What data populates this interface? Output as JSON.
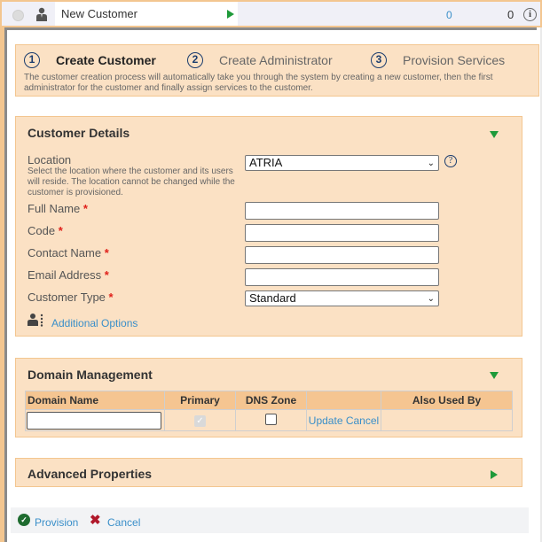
{
  "header": {
    "title": "New Customer",
    "count_link": "0",
    "count": "0",
    "icons": [
      "status-radio",
      "user-icon",
      "play-icon",
      "info-icon"
    ]
  },
  "steps": {
    "items": [
      {
        "number": "1",
        "label": "Create Customer",
        "active": true
      },
      {
        "number": "2",
        "label": "Create Administrator",
        "active": false
      },
      {
        "number": "3",
        "label": "Provision Services",
        "active": false
      }
    ],
    "description": "The customer creation process will automatically take you through the system by creating a new customer, then the first administrator for the customer and finally assign services to the customer."
  },
  "customer_details": {
    "title": "Customer Details",
    "location": {
      "label": "Location",
      "help": "Select the location where the customer and its users will reside. The location cannot be changed while the customer is provisioned.",
      "value": "ATRIA"
    },
    "fields": [
      {
        "label": "Full Name",
        "value": "",
        "required": true
      },
      {
        "label": "Code",
        "value": "",
        "required": true
      },
      {
        "label": "Contact Name",
        "value": "",
        "required": true
      },
      {
        "label": "Email Address",
        "value": "",
        "required": true
      }
    ],
    "customer_type": {
      "label": "Customer Type",
      "value": "Standard",
      "required": true
    },
    "required_marker": "*",
    "additional_options": "Additional Options"
  },
  "domain_management": {
    "title": "Domain Management",
    "columns": [
      "Domain Name",
      "Primary",
      "DNS Zone",
      "",
      "Also Used By"
    ],
    "row": {
      "domain_name": "",
      "primary_checked": true,
      "dns_zone_checked": false,
      "update_label": "Update",
      "cancel_label": "Cancel",
      "also_used_by": ""
    }
  },
  "advanced_properties": {
    "title": "Advanced Properties"
  },
  "actions": {
    "provision": "Provision",
    "cancel": "Cancel"
  },
  "colors": {
    "panel_bg": "#fbe1c4",
    "panel_border": "#f3c690",
    "table_header": "#f5c591",
    "link": "#3a8fc9",
    "toggle_green": "#1f9a3a",
    "required_red": "#e0201a"
  }
}
